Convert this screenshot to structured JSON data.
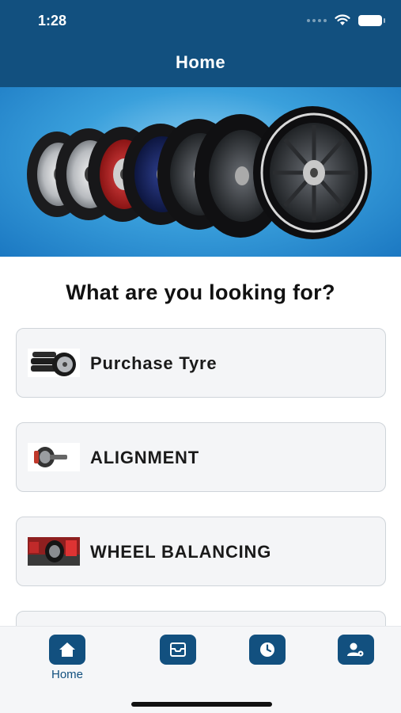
{
  "status_bar": {
    "time": "1:28"
  },
  "header": {
    "title": "Home"
  },
  "banner": {
    "description_icon": "tyre-lineup-image"
  },
  "main": {
    "question": "What are you looking for?",
    "options": [
      {
        "label": "Purchase Tyre",
        "icon": "tyres-image"
      },
      {
        "label": "ALIGNMENT",
        "icon": "alignment-image"
      },
      {
        "label": "WHEEL BALANCING",
        "icon": "wheel-balancing-image"
      },
      {
        "label": "",
        "icon": ""
      }
    ]
  },
  "tabbar": {
    "tabs": [
      {
        "label": "Home",
        "icon": "home-icon",
        "active": true
      },
      {
        "label": "",
        "icon": "inbox-icon",
        "active": false
      },
      {
        "label": "",
        "icon": "clock-icon",
        "active": false
      },
      {
        "label": "",
        "icon": "user-settings-icon",
        "active": false
      }
    ]
  },
  "colors": {
    "primary": "#12507f",
    "card_bg": "#f4f5f7",
    "card_border": "#cfd4d9"
  }
}
